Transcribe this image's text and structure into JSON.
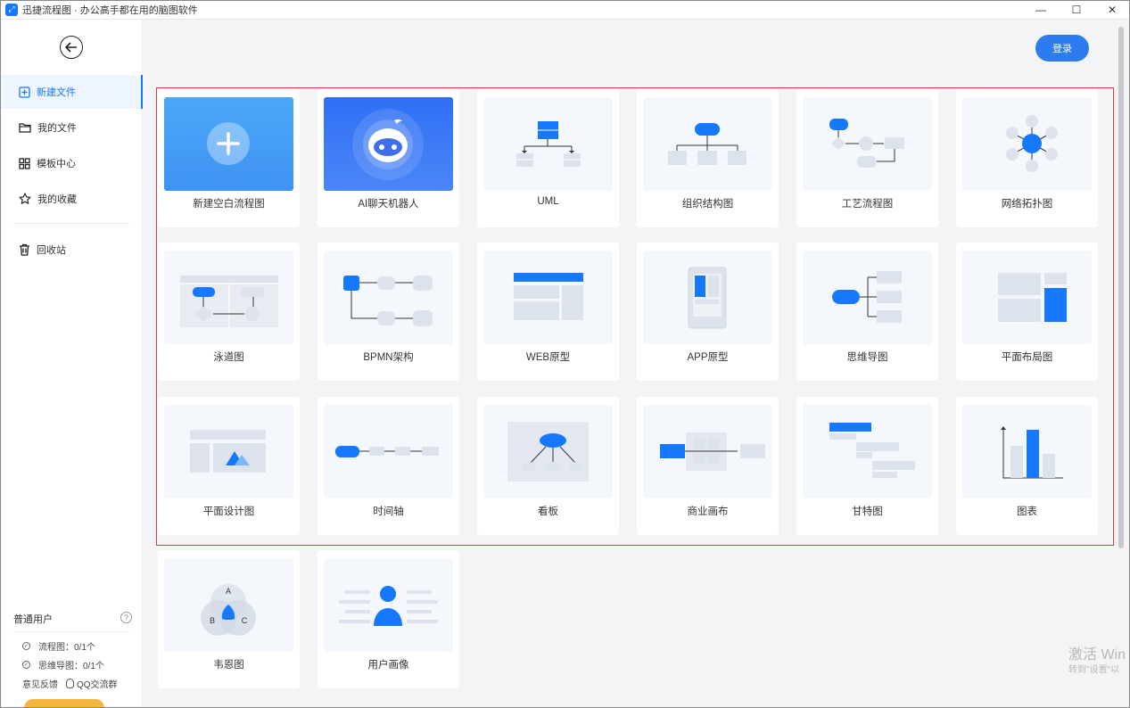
{
  "window": {
    "title": "迅捷流程图 · 办公高手都在用的脑图软件",
    "controls": [
      "—",
      "☐",
      "✕"
    ]
  },
  "sidebar": {
    "items": [
      {
        "label": "新建文件",
        "icon": "file-plus-icon",
        "active": true
      },
      {
        "label": "我的文件",
        "icon": "folder-icon",
        "active": false
      },
      {
        "label": "模板中心",
        "icon": "grid-icon",
        "active": false
      },
      {
        "label": "我的收藏",
        "icon": "star-icon",
        "active": false
      },
      {
        "label": "回收站",
        "icon": "trash-icon",
        "active": false
      }
    ],
    "user_level": "普通用户",
    "quota": [
      {
        "label": "流程图：0/1个"
      },
      {
        "label": "思维导图：0/1个"
      }
    ],
    "feedback": "意见反馈",
    "qq_group": "QQ交流群"
  },
  "header": {
    "login_label": "登录"
  },
  "templates": [
    {
      "label": "新建空白流程图",
      "thumb": "new-blank"
    },
    {
      "label": "AI聊天机器人",
      "thumb": "ai-bot"
    },
    {
      "label": "UML",
      "thumb": "uml"
    },
    {
      "label": "组织结构图",
      "thumb": "org-chart"
    },
    {
      "label": "工艺流程图",
      "thumb": "process-flow"
    },
    {
      "label": "网络拓扑图",
      "thumb": "network-topology"
    },
    {
      "label": "泳道图",
      "thumb": "swimlane"
    },
    {
      "label": "BPMN架构",
      "thumb": "bpmn"
    },
    {
      "label": "WEB原型",
      "thumb": "web-prototype"
    },
    {
      "label": "APP原型",
      "thumb": "app-prototype"
    },
    {
      "label": "思维导图",
      "thumb": "mind-map"
    },
    {
      "label": "平面布局图",
      "thumb": "floor-layout"
    },
    {
      "label": "平面设计图",
      "thumb": "graphic-design"
    },
    {
      "label": "时间轴",
      "thumb": "timeline"
    },
    {
      "label": "看板",
      "thumb": "kanban"
    },
    {
      "label": "商业画布",
      "thumb": "business-canvas"
    },
    {
      "label": "甘特图",
      "thumb": "gantt"
    },
    {
      "label": "图表",
      "thumb": "chart"
    },
    {
      "label": "韦恩图",
      "thumb": "venn"
    },
    {
      "label": "用户画像",
      "thumb": "user-persona"
    }
  ],
  "venn_letters": [
    "A",
    "B",
    "C"
  ],
  "watermark": {
    "line1": "激活 Win",
    "line2": "转到\"设置\"以"
  },
  "colors": {
    "accent": "#1677ff",
    "highlight_border": "#e0383d"
  }
}
